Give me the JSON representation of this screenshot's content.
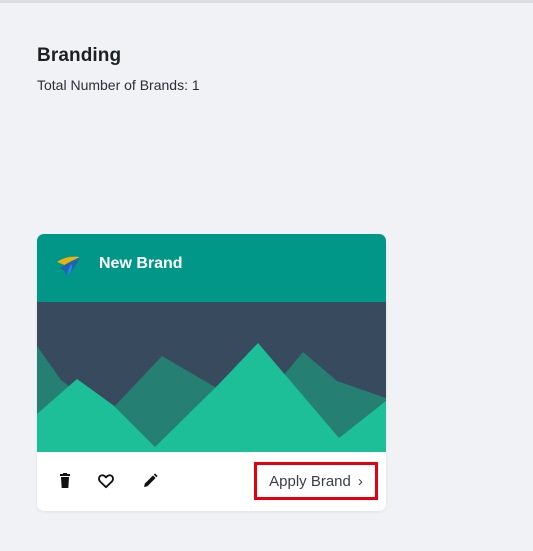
{
  "page": {
    "title": "Branding",
    "subtitle": "Total Number of Brands: 1"
  },
  "brand_card": {
    "name": "New Brand",
    "header_color": "#009688",
    "preview_background": "#374a5e",
    "preview_mountain_dark": "#257f72",
    "preview_mountain_light": "#1dbf98",
    "logo_icon": "leaf-logo-icon",
    "actions": [
      {
        "icon": "delete-icon",
        "color": "#111111"
      },
      {
        "icon": "heart-icon",
        "color": "#111111"
      },
      {
        "icon": "edit-icon",
        "color": "#111111"
      }
    ],
    "apply_label": "Apply Brand",
    "apply_chevron": "›",
    "highlight_color": "#e3000f"
  }
}
